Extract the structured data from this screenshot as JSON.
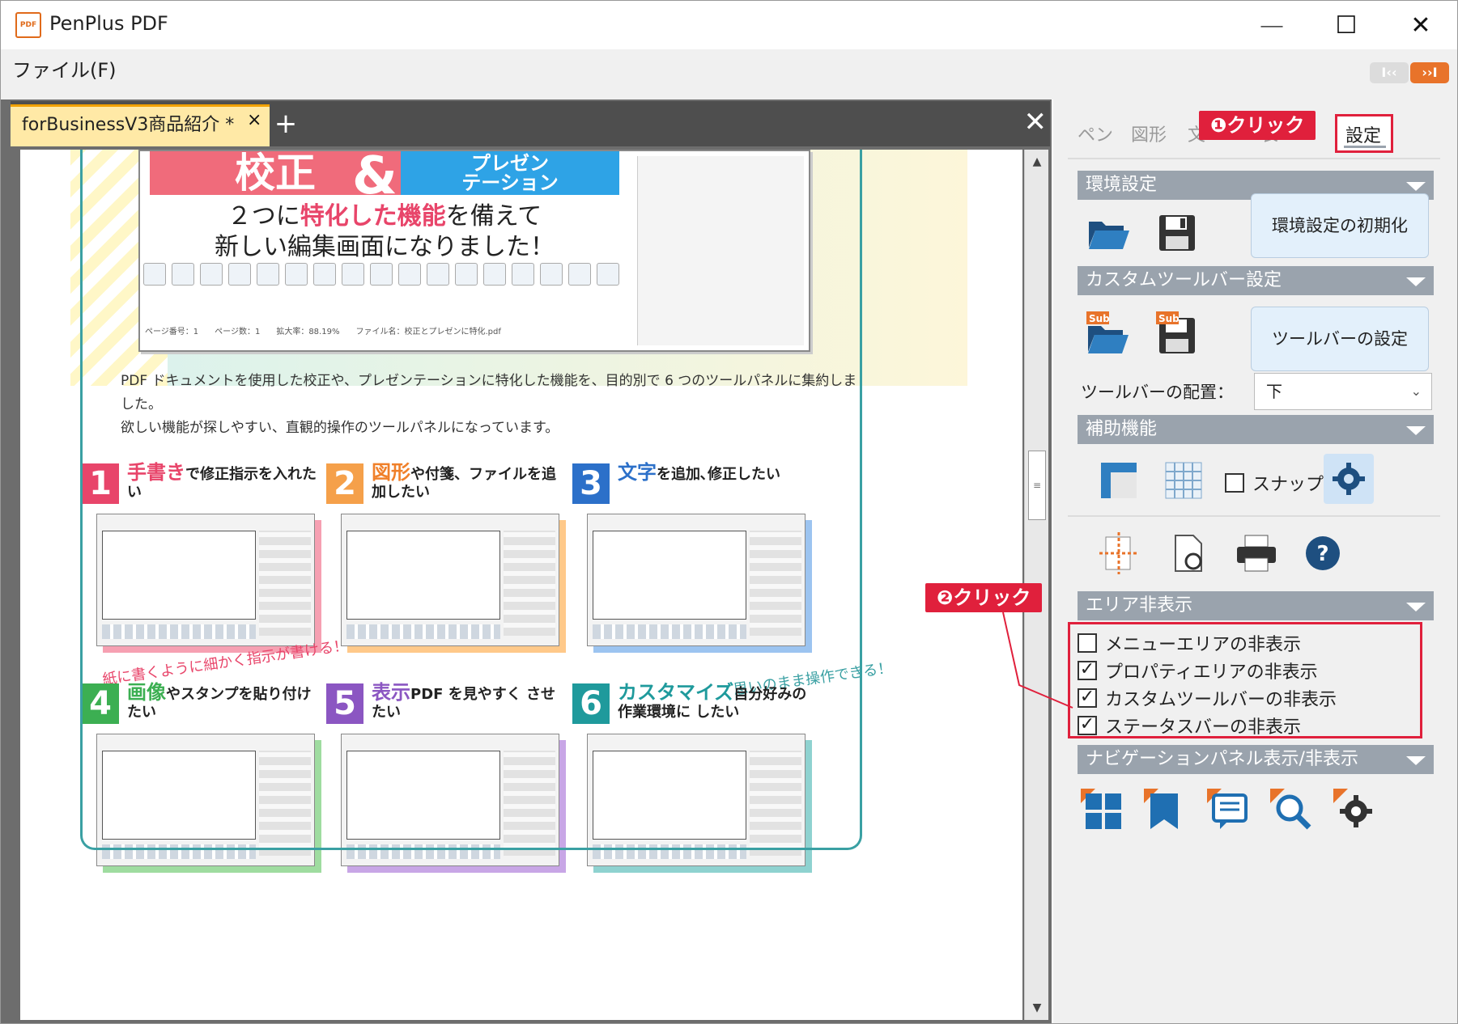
{
  "titlebar": {
    "app_name": "PenPlus PDF",
    "icon_text": "PDF",
    "minimize": "—",
    "maximize": "☐",
    "close": "✕"
  },
  "menubar": {
    "file": "ファイル(F)",
    "collapse_left": "I‹‹",
    "collapse_right": "››I"
  },
  "document": {
    "tab_title": "forBusinessV3商品紹介 *",
    "tab_close": "×",
    "tab_add": "+",
    "doc_close": "✕",
    "hero": {
      "red_label": "校正",
      "amp": "&",
      "blue_label_1": "プレゼン",
      "blue_label_2": "テーション",
      "line1_a": "２つに",
      "line1_b": "特化した機能",
      "line1_c": "を備えて",
      "line2": "新しい編集画面になりました！",
      "status": "ページ番号：1　　ページ数：1　　拡大率：88.19%　　ファイル名：校正とプレゼンに特化.pdf"
    },
    "intro_1": "PDF ドキュメントを使用した校正や、プレゼンテーションに特化した機能を、目的別で 6 つのツールパネルに集約しました。",
    "intro_2": "欲しい機能が探しやすい、直観的操作のツールパネルになっています。",
    "cards": [
      {
        "num": "1",
        "hl": "手書き",
        "rest": "で修正指示を入れたい"
      },
      {
        "num": "2",
        "hl": "図形",
        "rest": "や付箋、ファイルを追加したい"
      },
      {
        "num": "3",
        "hl": "文字",
        "rest": "を追加､修正したい"
      },
      {
        "num": "4",
        "hl": "画像",
        "rest": "やスタンプを貼り付けたい"
      },
      {
        "num": "5",
        "hl": "表示",
        "rest": "PDF を見やすく させたい"
      },
      {
        "num": "6",
        "hl": "カスタマイズ",
        "rest": "自分好みの作業環境に したい"
      }
    ],
    "note_1": "紙に書くように細かく指示が書ける！",
    "note_2": "思いのまま操作できる！",
    "scroll_up": "▲",
    "scroll_down": "▼",
    "scroll_grip": "≡"
  },
  "panel": {
    "tabs": [
      "ペン",
      "図形",
      "文",
      "表",
      "設定"
    ],
    "callout_1": "❶クリック",
    "callout_2": "❷クリック",
    "sections": {
      "env": "環境設定",
      "custom_toolbar": "カスタムツールバー設定",
      "assist": "補助機能",
      "area_hide": "エリア非表示",
      "nav": "ナビゲーションパネル表示/非表示"
    },
    "env_reset_button": "環境設定の初期化",
    "toolbar_settings_button": "ツールバーの設定",
    "toolbar_position_label": "ツールバーの配置：",
    "toolbar_position_value": "下",
    "sub_badge": "Sub",
    "snap_label": "スナップ",
    "area_checks": [
      {
        "label": "メニューエリアの非表示",
        "checked": false
      },
      {
        "label": "プロパティエリアの非表示",
        "checked": true
      },
      {
        "label": "カスタムツールバーの非表示",
        "checked": true
      },
      {
        "label": "ステータスバーの非表示",
        "checked": true
      }
    ],
    "check_mark": "✓"
  },
  "colors": {
    "accent_red": "#e0203c",
    "section_bg": "#9aa3ad",
    "icon_blue": "#1f6fb2",
    "icon_orange": "#e8732a",
    "tab_yellow": "#ffe9a6"
  }
}
